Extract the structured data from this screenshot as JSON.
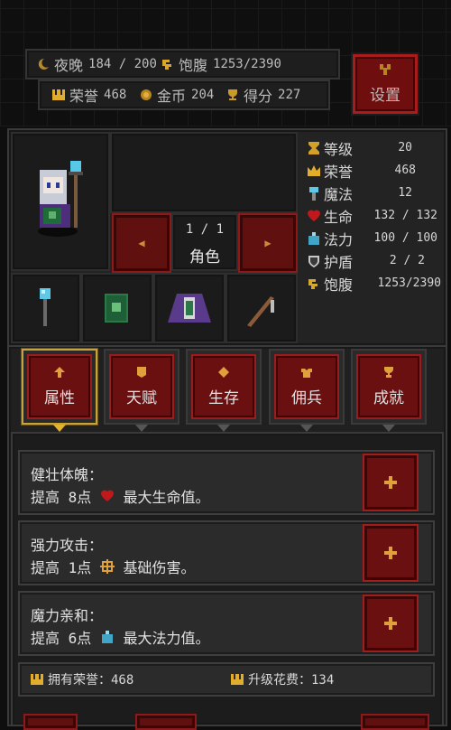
{
  "top_bar": {
    "time_label": "夜晚",
    "time_value": "184 / 200",
    "satiety_label": "饱腹",
    "satiety_value": "1253/2390",
    "honor_label": "荣誉",
    "honor_value": "468",
    "gold_label": "金币",
    "gold_value": "204",
    "score_label": "得分",
    "score_value": "227",
    "settings_label": "设置"
  },
  "character": {
    "page_indicator": "1 / 1",
    "page_title": "角色",
    "prev_arrow": "◀",
    "next_arrow": "▶"
  },
  "stats": [
    {
      "name": "等级",
      "value": "20",
      "icon": "hourglass-icon"
    },
    {
      "name": "荣誉",
      "value": "468",
      "icon": "crown-icon"
    },
    {
      "name": "魔法",
      "value": "12",
      "icon": "staff-icon"
    },
    {
      "name": "生命",
      "value": "132 / 132",
      "icon": "heart-icon"
    },
    {
      "name": "法力",
      "value": "100 / 100",
      "icon": "mana-potion-icon"
    },
    {
      "name": "护盾",
      "value": "2 / 2",
      "icon": "shield-icon"
    },
    {
      "name": "饱腹",
      "value": "1253/2390",
      "icon": "food-icon"
    }
  ],
  "equipment": [
    "staff-item",
    "spellbook-item",
    "robe-item",
    "wand-item"
  ],
  "tabs": [
    {
      "label": "属性",
      "active": true,
      "icon": "arrow-up-icon"
    },
    {
      "label": "天赋",
      "active": false,
      "icon": "banner-icon"
    },
    {
      "label": "生存",
      "active": false,
      "icon": "diamond-icon"
    },
    {
      "label": "佣兵",
      "active": false,
      "icon": "armor-icon"
    },
    {
      "label": "成就",
      "active": false,
      "icon": "trophy-icon"
    }
  ],
  "skills": [
    {
      "title": "健壮体魄：",
      "prefix": "提高 8点 ",
      "icon": "heart-icon",
      "suffix": " 最大生命值。"
    },
    {
      "title": "强力攻击：",
      "prefix": "提高 1点 ",
      "icon": "sparkle-icon",
      "suffix": " 基础伤害。"
    },
    {
      "title": "魔力亲和：",
      "prefix": "提高 6点 ",
      "icon": "mana-potion-icon",
      "suffix": " 最大法力值。"
    }
  ],
  "footer": {
    "owned_honor": "拥有荣誉：468",
    "upgrade_cost": "升级花费：134"
  },
  "colors": {
    "accent_red": "#6b1010",
    "gold": "#e2ad2a",
    "heart": "#c0181b",
    "mana": "#3fa6c8"
  }
}
